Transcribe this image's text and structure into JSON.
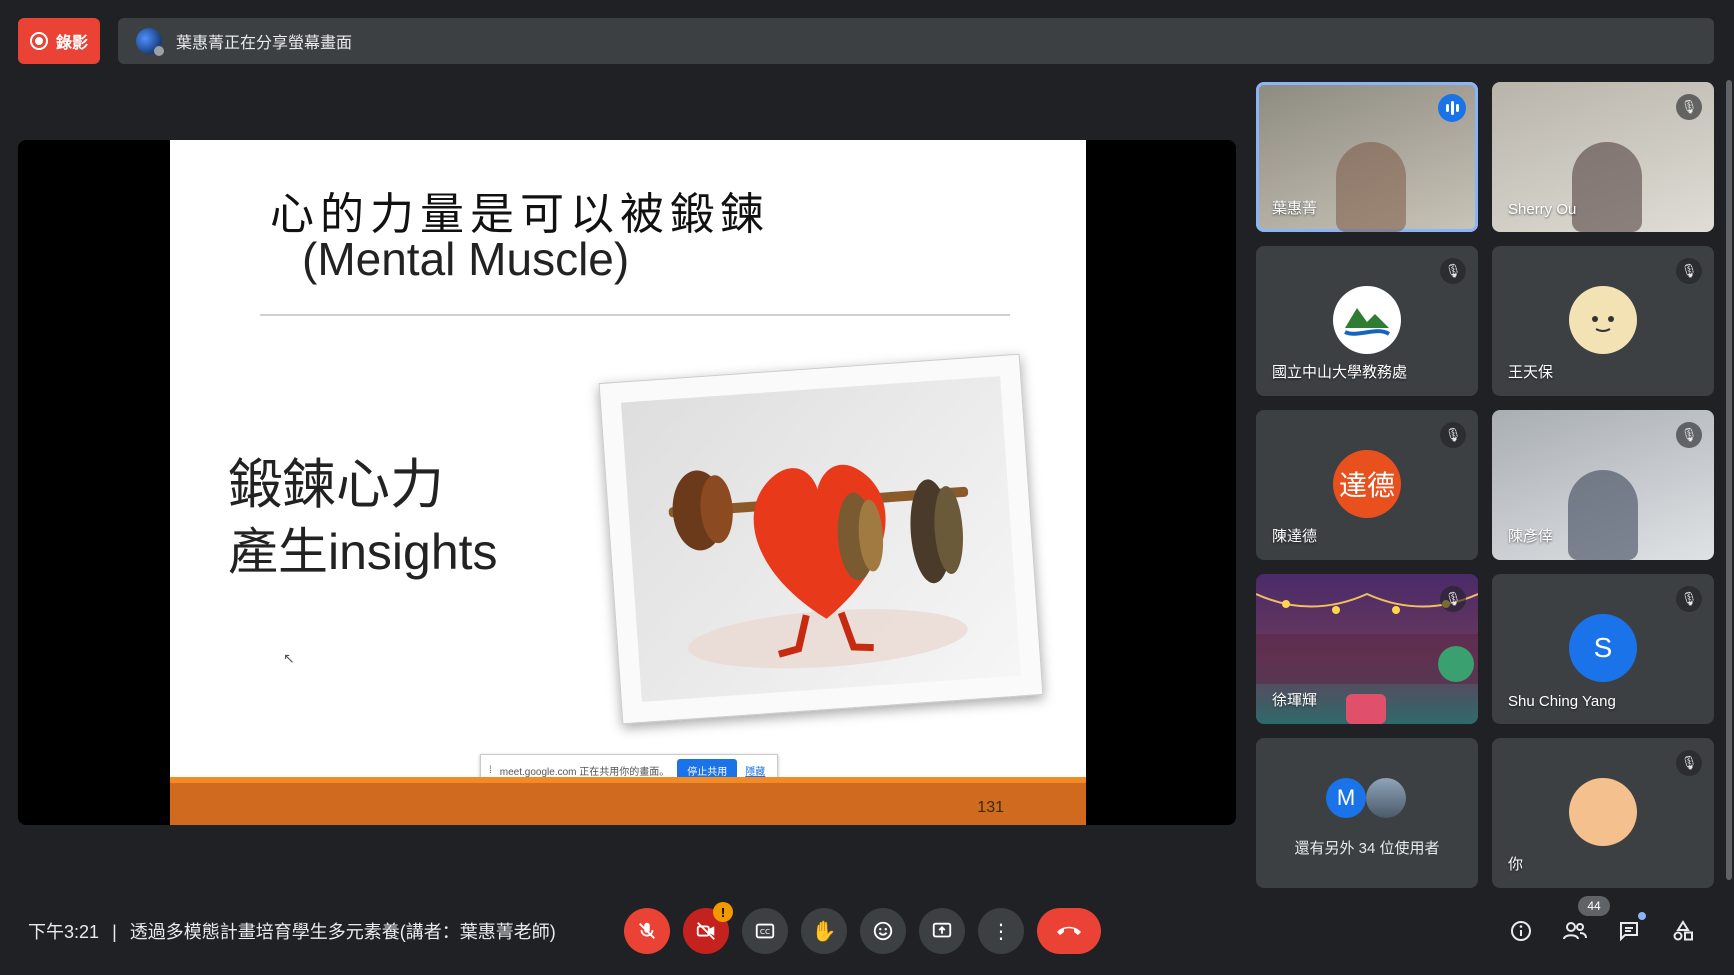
{
  "top_bar": {
    "record_label": "錄影",
    "share_status": "葉惠菁正在分享螢幕畫面"
  },
  "slide": {
    "title": "心的力量是可以被鍛鍊",
    "subtitle": "(Mental Muscle)",
    "body_line1": "鍛鍊心力",
    "body_line2": "產生insights",
    "page_number": "131",
    "share_popup_text": "meet.google.com 正在共用你的畫面。",
    "share_popup_stop": "停止共用",
    "share_popup_hide": "隱藏"
  },
  "participants": [
    {
      "name": "葉惠菁"
    },
    {
      "name": "Sherry Ou"
    },
    {
      "name": "國立中山大學教務處"
    },
    {
      "name": "王天保"
    },
    {
      "name": "陳達德",
      "avatar_text": "達德"
    },
    {
      "name": "陳彥倖"
    },
    {
      "name": "徐琿輝"
    },
    {
      "name": "Shu Ching Yang",
      "avatar_text": "S"
    },
    {
      "name": "還有另外 34 位使用者",
      "avatar_text": "M"
    },
    {
      "name": "你"
    }
  ],
  "bottom_bar": {
    "time": "下午3:21",
    "separator": "|",
    "meeting_title": "透過多模態計畫培育學生多元素養(講者：葉惠菁老師)",
    "camera_warning": "!",
    "participant_count": "44"
  },
  "colors": {
    "background": "#202124",
    "tile": "#3c4043",
    "danger": "#ea4335",
    "accent": "#1a73e8",
    "slide_footer": "#d06a1e"
  },
  "icons": [
    "record-icon",
    "mic-off-icon",
    "camera-off-icon",
    "captions-icon",
    "raise-hand-icon",
    "emoji-icon",
    "present-icon",
    "more-icon",
    "end-call-icon",
    "info-icon",
    "people-icon",
    "chat-icon",
    "activities-icon"
  ]
}
